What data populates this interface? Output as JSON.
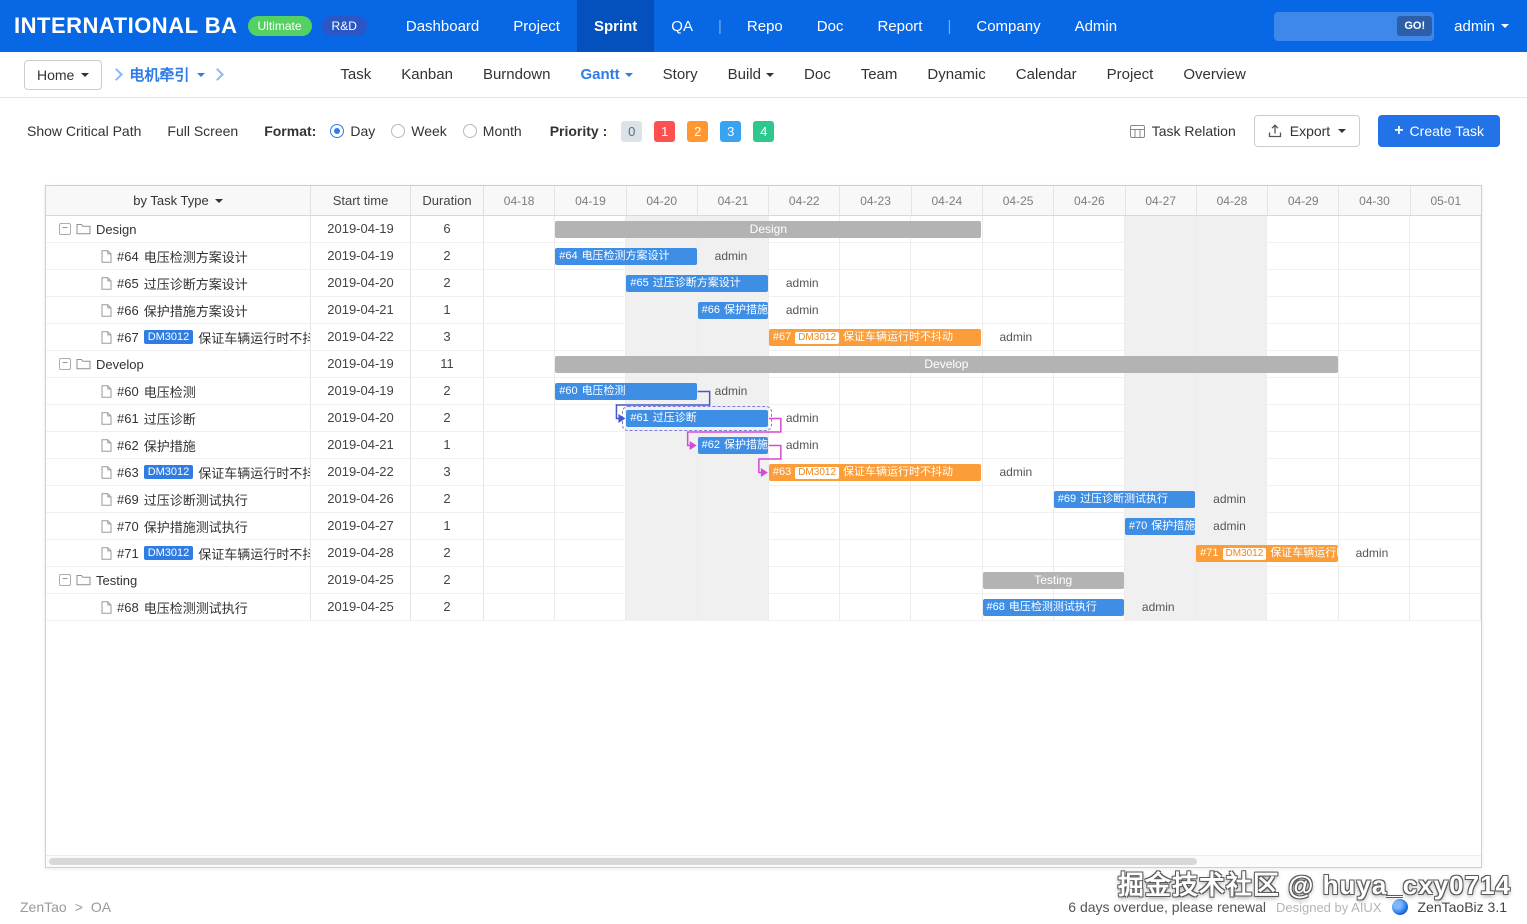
{
  "navbar": {
    "brand": "INTERNATIONAL BA",
    "edition_badge": "Ultimate",
    "rd_badge": "R&D",
    "menu": [
      {
        "label": "Dashboard"
      },
      {
        "label": "Project"
      },
      {
        "label": "Sprint",
        "active": true
      },
      {
        "label": "QA"
      },
      {
        "divider": true
      },
      {
        "label": "Repo"
      },
      {
        "label": "Doc"
      },
      {
        "label": "Report"
      },
      {
        "divider": true
      },
      {
        "label": "Company"
      },
      {
        "label": "Admin"
      }
    ],
    "search_placeholder": "",
    "search_button": "GO!",
    "user": "admin"
  },
  "subnav": {
    "home": "Home",
    "breadcrumb": "电机牵引",
    "tabs": [
      {
        "label": "Task"
      },
      {
        "label": "Kanban"
      },
      {
        "label": "Burndown"
      },
      {
        "label": "Gantt",
        "active": true,
        "caret": true
      },
      {
        "label": "Story"
      },
      {
        "label": "Build",
        "caret": true
      },
      {
        "label": "Doc"
      },
      {
        "label": "Team"
      },
      {
        "label": "Dynamic"
      },
      {
        "label": "Calendar"
      },
      {
        "label": "Project"
      },
      {
        "label": "Overview"
      }
    ]
  },
  "toolbar": {
    "show_critical_path": "Show Critical Path",
    "full_screen": "Full Screen",
    "format_label": "Format:",
    "format_options": [
      {
        "label": "Day",
        "selected": true
      },
      {
        "label": "Week",
        "selected": false
      },
      {
        "label": "Month",
        "selected": false
      }
    ],
    "priority_label": "Priority :",
    "priorities": [
      {
        "label": "0",
        "bg": "#dbe2e9",
        "fg": "#5d6b78"
      },
      {
        "label": "1",
        "bg": "#ff5050",
        "fg": "#ffffff"
      },
      {
        "label": "2",
        "bg": "#ff9833",
        "fg": "#ffffff"
      },
      {
        "label": "3",
        "bg": "#38a3f1",
        "fg": "#ffffff"
      },
      {
        "label": "4",
        "bg": "#2dc98c",
        "fg": "#ffffff"
      }
    ],
    "task_relation": "Task Relation",
    "export": "Export",
    "create_task": "Create Task"
  },
  "gantt": {
    "columns": {
      "task": "by Task Type",
      "start": "Start time",
      "duration": "Duration"
    },
    "dates": [
      "04-18",
      "04-19",
      "04-20",
      "04-21",
      "04-22",
      "04-23",
      "04-24",
      "04-25",
      "04-26",
      "04-27",
      "04-28",
      "04-29",
      "04-30",
      "05-01"
    ],
    "weekend_indexes": [
      2,
      3,
      9,
      10
    ],
    "colors": {
      "task_bar": "#3e8ee6",
      "story_bar": "#fb9d38",
      "group_bar": "#b3b3b3",
      "table_badge": "#2f7ce2",
      "link_blue": "#4658c8",
      "link_magenta": "#d44ad4"
    },
    "rows": [
      {
        "kind": "group",
        "title": "Design",
        "start": "2019-04-19",
        "duration": "6",
        "bar": {
          "offset": 1,
          "span": 6,
          "style": "group",
          "label": "Design"
        }
      },
      {
        "kind": "task",
        "id": "#64",
        "title": "电压检测方案设计",
        "start": "2019-04-19",
        "duration": "2",
        "bar": {
          "offset": 1,
          "span": 2,
          "style": "task",
          "assignee": "admin"
        }
      },
      {
        "kind": "task",
        "id": "#65",
        "title": "过压诊断方案设计",
        "start": "2019-04-20",
        "duration": "2",
        "bar": {
          "offset": 2,
          "span": 2,
          "style": "task",
          "assignee": "admin"
        }
      },
      {
        "kind": "task",
        "id": "#66",
        "title": "保护措施方案设计",
        "start": "2019-04-21",
        "duration": "1",
        "bar": {
          "offset": 3,
          "span": 1,
          "style": "task",
          "assignee": "admin"
        }
      },
      {
        "kind": "task",
        "id": "#67",
        "badge": "DM3012",
        "title": "保证车辆运行时不抖动",
        "start": "2019-04-22",
        "duration": "3",
        "bar": {
          "offset": 4,
          "span": 3,
          "style": "story",
          "assignee": "admin"
        }
      },
      {
        "kind": "group",
        "title": "Develop",
        "start": "2019-04-19",
        "duration": "11",
        "bar": {
          "offset": 1,
          "span": 11,
          "style": "group",
          "label": "Develop"
        }
      },
      {
        "kind": "task",
        "id": "#60",
        "title": "电压检测",
        "start": "2019-04-19",
        "duration": "2",
        "bar": {
          "offset": 1,
          "span": 2,
          "style": "task",
          "assignee": "admin"
        }
      },
      {
        "kind": "task",
        "id": "#61",
        "title": "过压诊断",
        "start": "2019-04-20",
        "duration": "2",
        "bar": {
          "offset": 2,
          "span": 2,
          "style": "task",
          "assignee": "admin",
          "selected": true
        }
      },
      {
        "kind": "task",
        "id": "#62",
        "title": "保护措施",
        "start": "2019-04-21",
        "duration": "1",
        "bar": {
          "offset": 3,
          "span": 1,
          "style": "task",
          "assignee": "admin"
        }
      },
      {
        "kind": "task",
        "id": "#63",
        "badge": "DM3012",
        "title": "保证车辆运行时不抖动",
        "start": "2019-04-22",
        "duration": "3",
        "bar": {
          "offset": 4,
          "span": 3,
          "style": "story",
          "assignee": "admin"
        }
      },
      {
        "kind": "task",
        "id": "#69",
        "title": "过压诊断测试执行",
        "start": "2019-04-26",
        "duration": "2",
        "bar": {
          "offset": 8,
          "span": 2,
          "style": "task",
          "assignee": "admin"
        }
      },
      {
        "kind": "task",
        "id": "#70",
        "title": "保护措施测试执行",
        "start": "2019-04-27",
        "duration": "1",
        "bar": {
          "offset": 9,
          "span": 1,
          "style": "task",
          "assignee": "admin"
        }
      },
      {
        "kind": "task",
        "id": "#71",
        "badge": "DM3012",
        "title": "保证车辆运行时不抖动",
        "start": "2019-04-28",
        "duration": "2",
        "bar": {
          "offset": 10,
          "span": 2,
          "style": "story",
          "assignee": "admin"
        }
      },
      {
        "kind": "group",
        "title": "Testing",
        "start": "2019-04-25",
        "duration": "2",
        "bar": {
          "offset": 7,
          "span": 2,
          "style": "group",
          "label": "Testing"
        }
      },
      {
        "kind": "task",
        "id": "#68",
        "title": "电压检测测试执行",
        "start": "2019-04-25",
        "duration": "2",
        "bar": {
          "offset": 7,
          "span": 2,
          "style": "task",
          "assignee": "admin"
        }
      }
    ],
    "links": [
      {
        "from": 6,
        "to": 7,
        "color": "#4658c8"
      },
      {
        "from": 7,
        "to": 8,
        "color": "#d44ad4"
      },
      {
        "from": 8,
        "to": 9,
        "color": "#d44ad4"
      }
    ]
  },
  "footer": {
    "left_brand": "ZenTao",
    "left_sep": ">",
    "left_item": "OA",
    "renewal_notice": "6 days overdue, please renewal",
    "designed_by": "Designed by AIUX",
    "product": "ZenTaoBiz 3.1"
  },
  "watermark": "掘金技术社区 @ huya_cxy0714"
}
